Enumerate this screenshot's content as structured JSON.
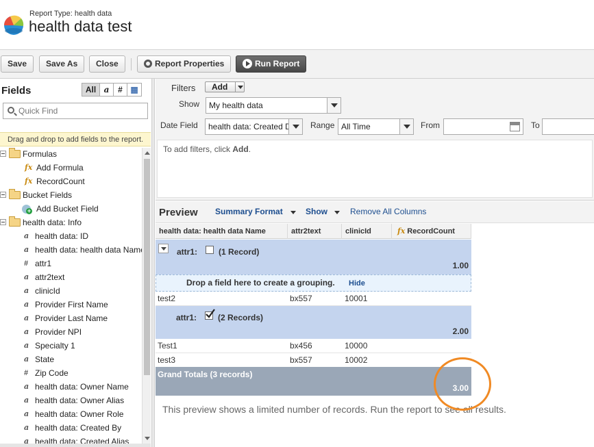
{
  "header": {
    "report_type": "Report Type: health data",
    "title": "health data test"
  },
  "toolbar": {
    "save": "Save",
    "save_as": "Save As",
    "close": "Close",
    "report_properties": "Report Properties",
    "run_report": "Run Report"
  },
  "fields": {
    "title": "Fields",
    "tabs": [
      "All",
      "a",
      "#",
      "▦"
    ],
    "quick_find_placeholder": "Quick Find",
    "hint": "Drag and drop to add fields to the report.",
    "tree": {
      "formulas": "Formulas",
      "add_formula": "Add Formula",
      "record_count": "RecordCount",
      "bucket_fields": "Bucket Fields",
      "add_bucket_field": "Add Bucket Field",
      "info": "health data: Info",
      "items": [
        {
          "type": "a",
          "label": "health data: ID"
        },
        {
          "type": "a",
          "label": "health data: health data Name"
        },
        {
          "type": "#",
          "label": "attr1"
        },
        {
          "type": "a",
          "label": "attr2text"
        },
        {
          "type": "a",
          "label": "clinicId"
        },
        {
          "type": "a",
          "label": "Provider First Name"
        },
        {
          "type": "a",
          "label": "Provider Last Name"
        },
        {
          "type": "a",
          "label": "Provider NPI"
        },
        {
          "type": "a",
          "label": "Specialty 1"
        },
        {
          "type": "a",
          "label": "State"
        },
        {
          "type": "#",
          "label": "Zip Code"
        },
        {
          "type": "a",
          "label": "health data: Owner Name"
        },
        {
          "type": "a",
          "label": "health data: Owner Alias"
        },
        {
          "type": "a",
          "label": "health data: Owner Role"
        },
        {
          "type": "a",
          "label": "health data: Created By"
        },
        {
          "type": "a",
          "label": "health data: Created Alias"
        }
      ]
    }
  },
  "filters": {
    "title": "Filters",
    "add": "Add",
    "show_label": "Show",
    "show_value": "My health data",
    "date_field_label": "Date Field",
    "date_field_value": "health data: Created D",
    "range_label": "Range",
    "range_value": "All Time",
    "from_label": "From",
    "to_label": "To",
    "hint_prefix": "To add filters, click",
    "hint_action": "Add",
    "hint_suffix": "."
  },
  "preview": {
    "title": "Preview",
    "summary_format": "Summary Format",
    "show": "Show",
    "remove_all_columns": "Remove All Columns",
    "columns": [
      "health data: health data Name",
      "attr2text",
      "clinicId",
      "RecordCount"
    ],
    "group1": {
      "label": "attr1:",
      "count": "(1 Record)",
      "sum": "1.00"
    },
    "drop_zone": {
      "text": "Drop a field here to create a grouping.",
      "link": "Hide"
    },
    "group1_rows": [
      {
        "name": "test2",
        "attr2text": "bx557",
        "clinicId": "10001"
      }
    ],
    "group2": {
      "label": "attr1:",
      "count": "(2 Records)",
      "sum": "2.00"
    },
    "group2_rows": [
      {
        "name": "Test1",
        "attr2text": "bx456",
        "clinicId": "10000"
      },
      {
        "name": "test3",
        "attr2text": "bx557",
        "clinicId": "10002"
      }
    ],
    "grand_total": {
      "label": "Grand Totals (3 records)",
      "value": "3.00"
    },
    "note": "This preview shows a limited number of records. Run the report to see all results."
  },
  "colors": {
    "group_bg": "#c4d4ee",
    "grand_total_bg": "#9aa7b7",
    "link": "#1d4e8f",
    "annotation_circle": "#f08a24"
  }
}
